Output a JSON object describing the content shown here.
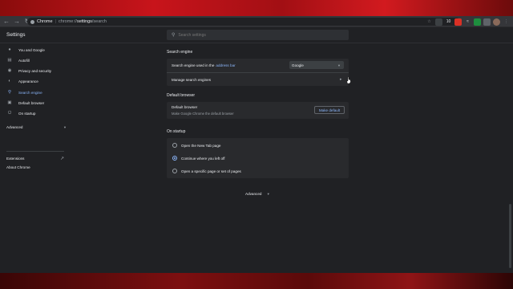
{
  "browser": {
    "omnibox_chip": "Chrome",
    "url_scheme": "chrome://",
    "url_host": "settings",
    "url_path": "/search",
    "ext_badge": "10",
    "colors": {
      "desktop": "#c8141b",
      "accent": "#8ab4f8",
      "window_bg": "#202124",
      "card_bg": "#292a2d"
    }
  },
  "header": {
    "title": "Settings",
    "search_placeholder": "Search settings"
  },
  "sidebar": {
    "items": [
      {
        "label": "You and Google",
        "icon": "person-icon"
      },
      {
        "label": "Autofill",
        "icon": "clipboard-icon"
      },
      {
        "label": "Privacy and security",
        "icon": "shield-icon"
      },
      {
        "label": "Appearance",
        "icon": "palette-icon"
      },
      {
        "label": "Search engine",
        "icon": "search-icon",
        "active": true
      },
      {
        "label": "Default browser",
        "icon": "browser-icon"
      },
      {
        "label": "On startup",
        "icon": "power-icon"
      }
    ],
    "advanced": "Advanced",
    "extensions": "Extensions",
    "about": "About Chrome"
  },
  "main": {
    "search_engine": {
      "title": "Search engine",
      "used_label": "Search engine used in the",
      "used_link": "address bar",
      "selected_engine": "Google",
      "manage_label": "Manage search engines"
    },
    "default_browser": {
      "title": "Default browser",
      "heading": "Default browser",
      "subtext": "Make Google Chrome the default browser",
      "button": "Make default"
    },
    "on_startup": {
      "title": "On startup",
      "options": [
        {
          "label": "Open the New Tab page",
          "checked": false
        },
        {
          "label": "Continue where you left off",
          "checked": true
        },
        {
          "label": "Open a specific page or set of pages",
          "checked": false
        }
      ]
    },
    "advanced": "Advanced"
  }
}
